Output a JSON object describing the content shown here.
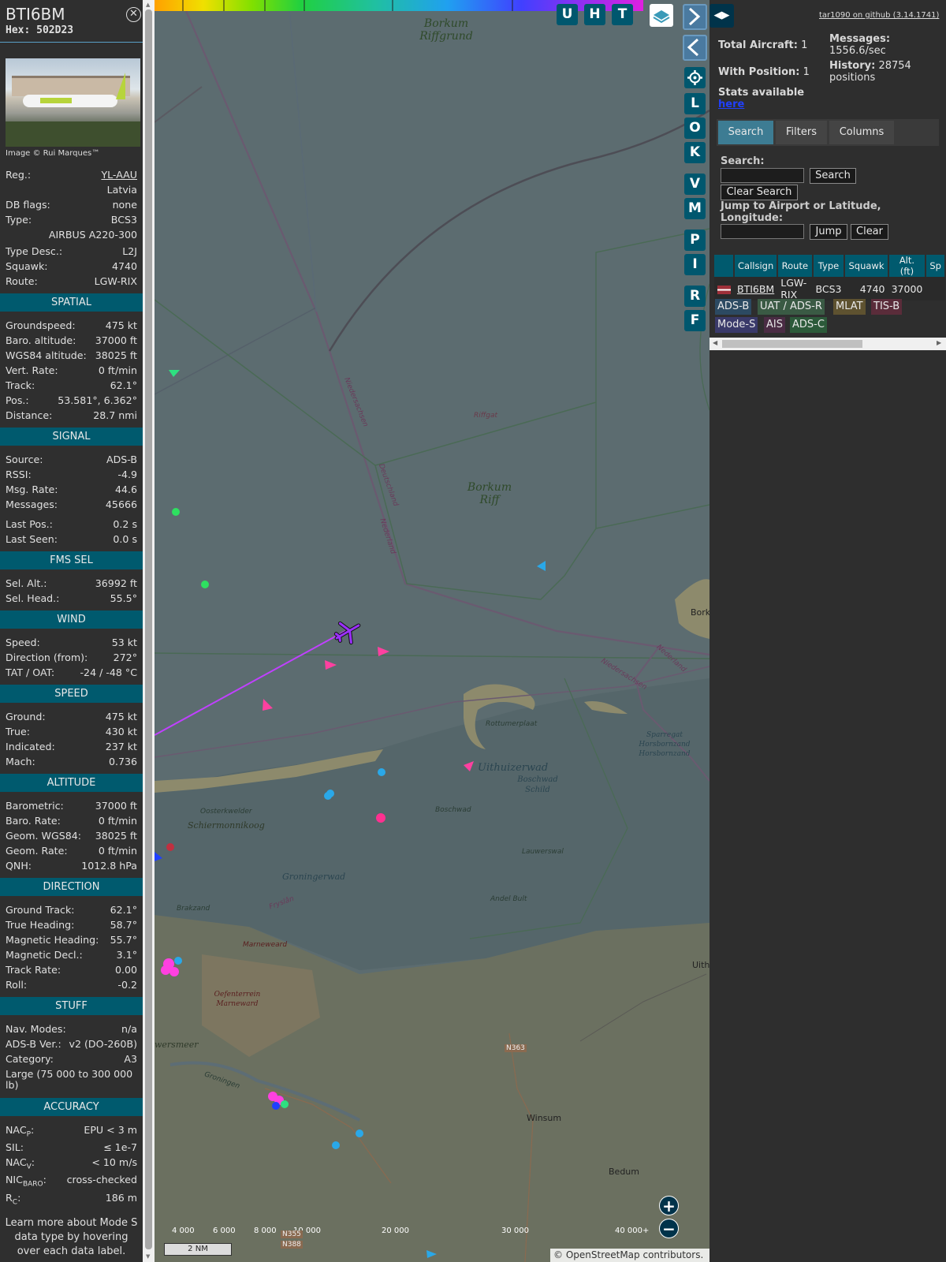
{
  "info": {
    "callsign": "BTI6BM",
    "hex": "Hex: 502D23",
    "photo_credit": "Image © Rui Marques™",
    "reg_label": "Reg.:",
    "reg": "YL-AAU",
    "country": "Latvia",
    "dbflags_label": "DB flags:",
    "dbflags": "none",
    "type_label": "Type:",
    "type": "BCS3",
    "type_name": "AIRBUS A220-300",
    "typedesc_label": "Type Desc.:",
    "typedesc": "L2J",
    "squawk_label": "Squawk:",
    "squawk": "4740",
    "route_label": "Route:",
    "route": "LGW-RIX",
    "sections": {
      "spatial": "SPATIAL",
      "signal": "SIGNAL",
      "fms": "FMS SEL",
      "wind": "WIND",
      "speed": "SPEED",
      "altitude": "ALTITUDE",
      "direction": "DIRECTION",
      "stuff": "STUFF",
      "accuracy": "ACCURACY"
    },
    "spatial": [
      [
        "Groundspeed:",
        "475 kt"
      ],
      [
        "Baro. altitude:",
        "37000 ft"
      ],
      [
        "WGS84 altitude:",
        "38025 ft"
      ],
      [
        "Vert. Rate:",
        "0 ft/min"
      ],
      [
        "Track:",
        "62.1°"
      ],
      [
        "Pos.:",
        "53.581°, 6.362°"
      ],
      [
        "Distance:",
        "28.7 nmi"
      ]
    ],
    "signal": [
      [
        "Source:",
        "ADS-B"
      ],
      [
        "RSSI:",
        "-4.9"
      ],
      [
        "Msg. Rate:",
        "44.6"
      ],
      [
        "Messages:",
        "45666"
      ]
    ],
    "signal2": [
      [
        "Last Pos.:",
        "0.2 s"
      ],
      [
        "Last Seen:",
        "0.0 s"
      ]
    ],
    "fms": [
      [
        "Sel. Alt.:",
        "36992 ft"
      ],
      [
        "Sel. Head.:",
        "55.5°"
      ]
    ],
    "wind": [
      [
        "Speed:",
        "53 kt"
      ],
      [
        "Direction (from):",
        "272°"
      ],
      [
        "TAT / OAT:",
        "-24 / -48 °C"
      ]
    ],
    "speed": [
      [
        "Ground:",
        "475 kt"
      ],
      [
        "True:",
        "430 kt"
      ],
      [
        "Indicated:",
        "237 kt"
      ],
      [
        "Mach:",
        "0.736"
      ]
    ],
    "altitude": [
      [
        "Barometric:",
        "37000 ft"
      ],
      [
        "Baro. Rate:",
        "0 ft/min"
      ],
      [
        "Geom. WGS84:",
        "38025 ft"
      ],
      [
        "Geom. Rate:",
        "0 ft/min"
      ],
      [
        "QNH:",
        "1012.8 hPa"
      ]
    ],
    "direction": [
      [
        "Ground Track:",
        "62.1°"
      ],
      [
        "True Heading:",
        "58.7°"
      ],
      [
        "Magnetic Heading:",
        "55.7°"
      ],
      [
        "Magnetic Decl.:",
        "3.1°"
      ],
      [
        "Track Rate:",
        "0.00"
      ],
      [
        "Roll:",
        "-0.2"
      ]
    ],
    "stuff": [
      [
        "Nav. Modes:",
        "n/a"
      ],
      [
        "ADS-B Ver.:",
        "v2 (DO-260B)"
      ],
      [
        "Category:",
        "A3"
      ]
    ],
    "stuff_category_desc": "Large (75 000 to 300 000 lb)",
    "accuracy": {
      "nacp_label": "NAC",
      "nacp_sub": "P",
      "nacp": "EPU < 3 m",
      "sil_label": "SIL:",
      "sil": "≤ 1e-7",
      "nacv_label": "NAC",
      "nacv_sub": "V",
      "nacv": "< 10 m/s",
      "nicbaro_label": "NIC",
      "nicbaro_sub": "BARO",
      "nicbaro": "cross-checked",
      "rc_label": "R",
      "rc_sub": "C",
      "rc": "186 m"
    },
    "learn_more": "Learn more about Mode S data type by hovering over each data label."
  },
  "map": {
    "labels": {
      "borkum_riffgrund": "Borkum Riffgrund",
      "borkum_riff": "Borkum Riff",
      "riffgat": "Riffgat",
      "niedersachsen": "Niedersachsen",
      "deutschland": "Deutschland",
      "nederland": "Nederland",
      "niedersachsen2": "Niedersachsen",
      "nederland2": "Nederland",
      "rottumerplaat": "Rottumerplaat",
      "uithuizerwad": "Uithuizerwad",
      "boschwad_schild": "Boschwad Schild",
      "boschwad": "Boschwad",
      "sparregat": "Sparregat Horsbornzand Horsbornzand",
      "oosterkwelder": "Oosterkwelder",
      "schiermonnikoog": "Schiermonnikoog",
      "groningerwad": "Groningerwad",
      "lauwerswal": "Lauwerswal",
      "andel_bult": "Andel Bult",
      "brakzand": "Brakzand",
      "fryslan": "Fryslân",
      "marneweard": "Marneweard",
      "oefenterrein": "Oefenterrein Marneward",
      "wersmeer": "wersmeer",
      "groningen_road": "Groningen",
      "winsum": "Winsum",
      "bedum": "Bedum",
      "borkum_town": "Bork",
      "uith": "Uith",
      "n363": "N363",
      "n355": "N355",
      "n388": "N388"
    },
    "tools": [
      "U",
      "H",
      "T",
      "L",
      "O",
      "K",
      "V",
      "M",
      "P",
      "I",
      "R",
      "F"
    ],
    "zoom_in": "+",
    "zoom_out": "−",
    "colorbar_ticks": [
      "4 000",
      "6 000",
      "8 000",
      "10 000",
      "20 000",
      "30 000",
      "40 000+"
    ],
    "scale": "2 NM",
    "attribution": "© OpenStreetMap contributors."
  },
  "right": {
    "github": "tar1090 on github (3.14.1741)",
    "total_aircraft_label": "Total Aircraft:",
    "total_aircraft": "1",
    "with_position_label": "With Position:",
    "with_position": "1",
    "messages_label": "Messages:",
    "messages": "1556.6/sec",
    "history_label": "History:",
    "history": "28754 positions",
    "stats_label": "Stats available",
    "stats_link": "here",
    "tabs": [
      "Search",
      "Filters",
      "Columns"
    ],
    "search_label": "Search:",
    "search_button": "Search",
    "clear_search_button": "Clear Search",
    "jump_label": "Jump to Airport or Latitude, Longitude:",
    "jump_button": "Jump",
    "clear_button": "Clear",
    "table": {
      "headers": [
        "",
        "Callsign",
        "Route",
        "Type",
        "Squawk",
        "Alt. (ft)",
        "Sp"
      ],
      "rows": [
        {
          "callsign": "BTI6BM",
          "route": "LGW-RIX",
          "type": "BCS3",
          "squawk": "4740",
          "alt": "37000"
        }
      ]
    },
    "badges": [
      "ADS-B",
      "UAT / ADS-R",
      "MLAT",
      "TIS-B",
      "Mode-S",
      "AIS",
      "ADS-C"
    ]
  },
  "colors": {
    "section_bg": "#005a6e",
    "aircraft_marker": "#9b30ff",
    "track_line": "#c040ff",
    "map_water": "#5c6c70",
    "map_land": "#6b7060"
  }
}
